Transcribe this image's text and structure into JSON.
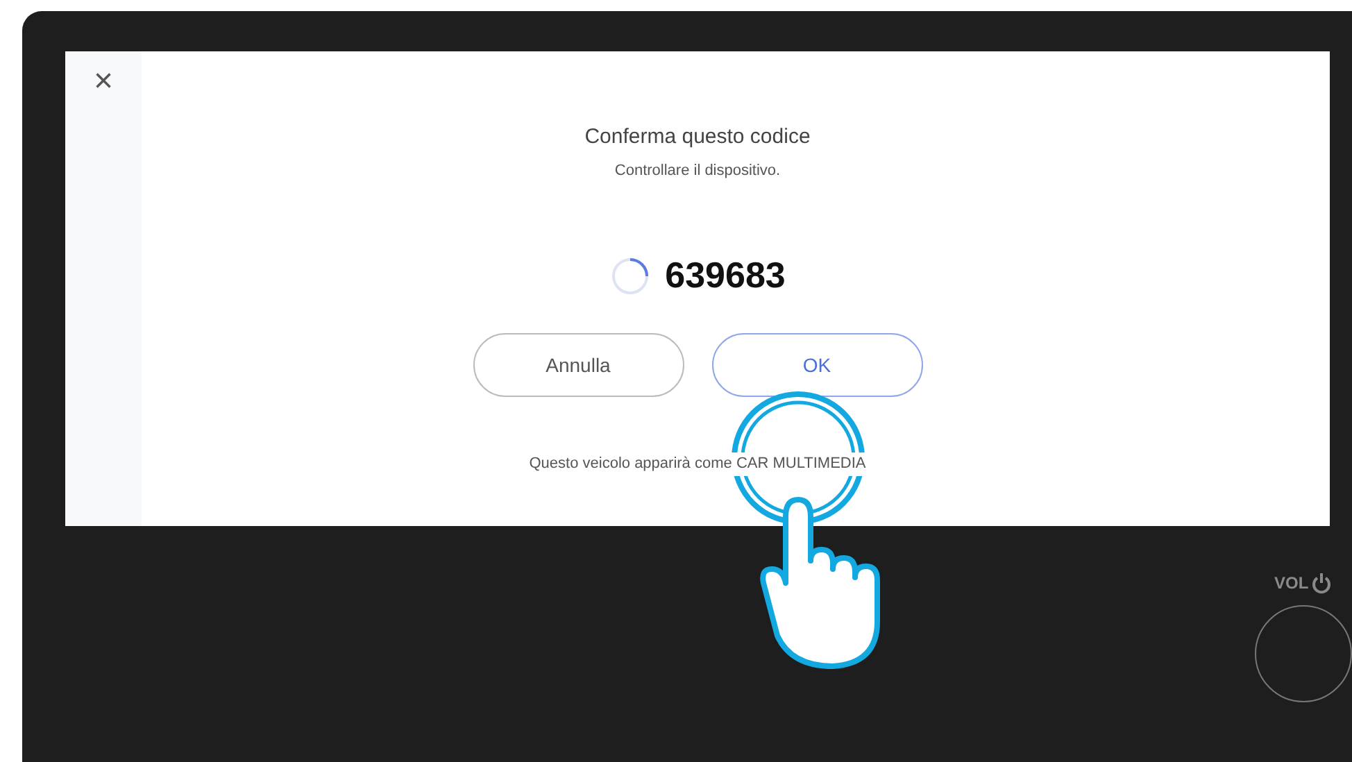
{
  "close": "×",
  "dialog": {
    "title": "Conferma questo codice",
    "subtitle": "Controllare il dispositivo.",
    "code": "639683",
    "buttons": [
      {
        "label": "Annulla",
        "kind": "secondary"
      },
      {
        "label": "OK",
        "kind": "primary"
      }
    ],
    "footer": "Questo veicolo apparirà come CAR MULTIMEDIA"
  },
  "hardware": {
    "volume_label": "VOL"
  }
}
